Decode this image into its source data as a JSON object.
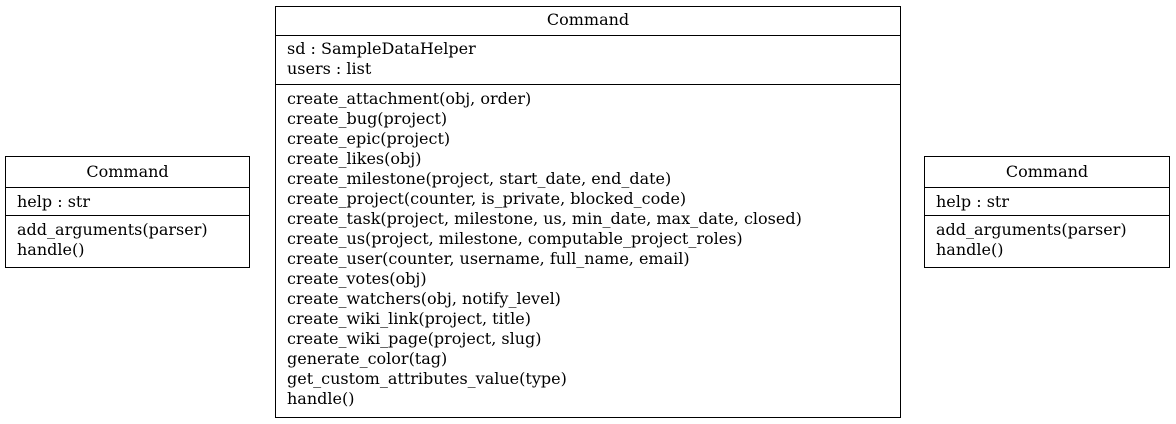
{
  "classes": {
    "left": {
      "name": "Command",
      "attributes": [
        "help : str"
      ],
      "methods": [
        "add_arguments(parser)",
        "handle()"
      ]
    },
    "center": {
      "name": "Command",
      "attributes": [
        "sd : SampleDataHelper",
        "users : list"
      ],
      "methods": [
        "create_attachment(obj, order)",
        "create_bug(project)",
        "create_epic(project)",
        "create_likes(obj)",
        "create_milestone(project, start_date, end_date)",
        "create_project(counter, is_private, blocked_code)",
        "create_task(project, milestone, us, min_date, max_date, closed)",
        "create_us(project, milestone, computable_project_roles)",
        "create_user(counter, username, full_name, email)",
        "create_votes(obj)",
        "create_watchers(obj, notify_level)",
        "create_wiki_link(project, title)",
        "create_wiki_page(project, slug)",
        "generate_color(tag)",
        "get_custom_attributes_value(type)",
        "handle()"
      ]
    },
    "right": {
      "name": "Command",
      "attributes": [
        "help : str"
      ],
      "methods": [
        "add_arguments(parser)",
        "handle()"
      ]
    }
  }
}
